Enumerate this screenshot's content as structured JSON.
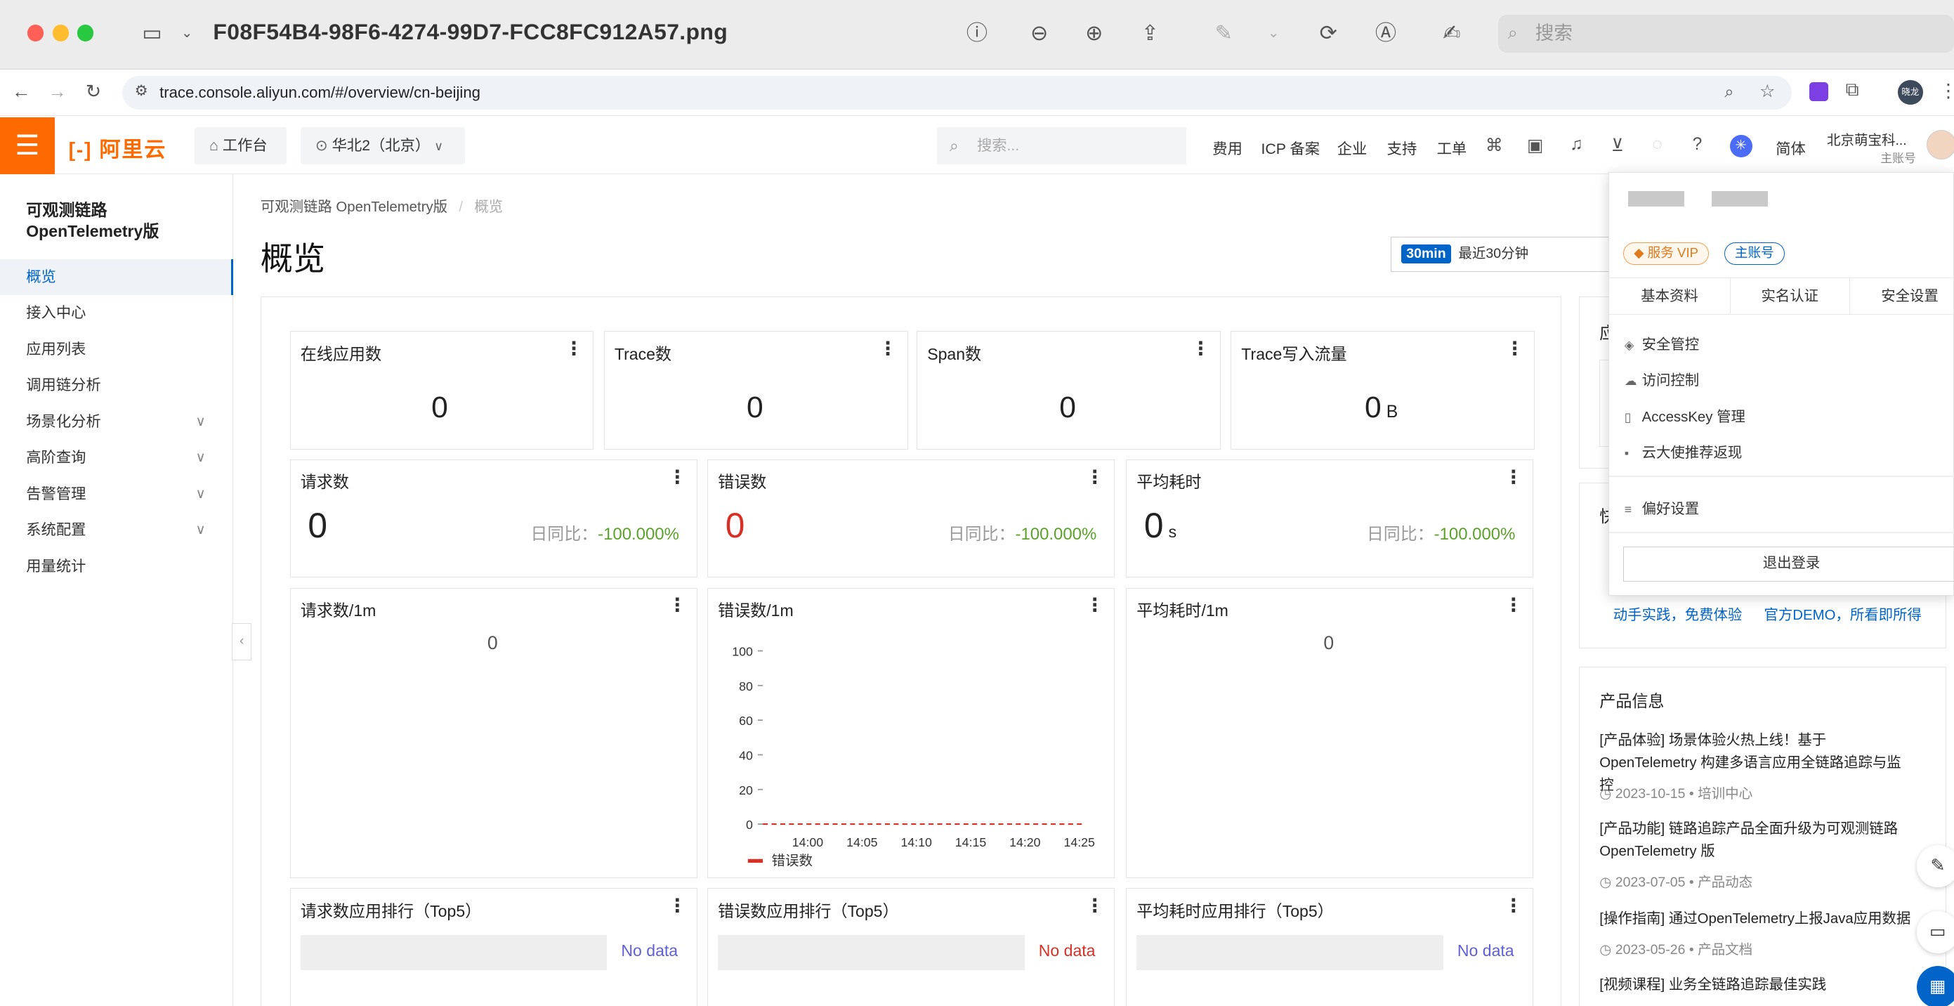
{
  "mac": {
    "filename": "F08F54B4-98F6-4274-99D7-FCC8FC912A57.png",
    "search_placeholder": "搜索"
  },
  "browser": {
    "url": "trace.console.aliyun.com/#/overview/cn-beijing",
    "profile": "晓龙"
  },
  "topnav": {
    "logo": "阿里云",
    "workspace": "工作台",
    "region": "华北2（北京）",
    "search_placeholder": "搜索...",
    "links": [
      "费用",
      "ICP 备案",
      "企业",
      "支持",
      "工单"
    ],
    "lang": "简体",
    "account_name": "北京萌宝科...",
    "account_role": "主账号"
  },
  "sidebar": {
    "title_line1": "可观测链路",
    "title_line2": "OpenTelemetry版",
    "items": [
      {
        "label": "概览"
      },
      {
        "label": "接入中心"
      },
      {
        "label": "应用列表"
      },
      {
        "label": "调用链分析"
      },
      {
        "label": "场景化分析"
      },
      {
        "label": "高阶查询"
      },
      {
        "label": "告警管理"
      },
      {
        "label": "系统配置"
      },
      {
        "label": "用量统计"
      }
    ]
  },
  "breadcrumb": {
    "root": "可观测链路 OpenTelemetry版",
    "sep": "/",
    "current": "概览"
  },
  "page_title": "概览",
  "time_range": {
    "badge": "30min",
    "label": "最近30分钟"
  },
  "stats_row1": [
    {
      "title": "在线应用数",
      "value": "0",
      "unit": ""
    },
    {
      "title": "Trace数",
      "value": "0",
      "unit": ""
    },
    {
      "title": "Span数",
      "value": "0",
      "unit": ""
    },
    {
      "title": "Trace写入流量",
      "value": "0",
      "unit": "B"
    }
  ],
  "stats_row2": [
    {
      "title": "请求数",
      "value": "0",
      "unit": "",
      "cmp_label": "日同比：",
      "cmp_value": "-100.000%"
    },
    {
      "title": "错误数",
      "value": "0",
      "unit": "",
      "cmp_label": "日同比：",
      "cmp_value": "-100.000%"
    },
    {
      "title": "平均耗时",
      "value": "0",
      "unit": "s",
      "cmp_label": "日同比：",
      "cmp_value": "-100.000%"
    }
  ],
  "charts_row": [
    {
      "title": "请求数/1m",
      "value": "0"
    },
    {
      "title": "错误数/1m"
    },
    {
      "title": "平均耗时/1m",
      "value": "0"
    }
  ],
  "chart_data": {
    "type": "line",
    "x": [
      "14:00",
      "14:05",
      "14:10",
      "14:15",
      "14:20",
      "14:25"
    ],
    "series": [
      {
        "name": "错误数",
        "values": [
          0,
          0,
          0,
          0,
          0,
          0
        ]
      }
    ],
    "ylim": [
      0,
      100
    ],
    "yticks": [
      "100",
      "80",
      "60",
      "40",
      "20",
      "0"
    ],
    "color": "#d93026"
  },
  "rank_row": [
    {
      "title": "请求数应用排行（Top5）",
      "nodata": "No data"
    },
    {
      "title": "错误数应用排行（Top5）",
      "nodata": "No data"
    },
    {
      "title": "平均耗时应用排行（Top5）",
      "nodata": "No data"
    }
  ],
  "right_col": {
    "box1_partial_title": "应",
    "box2_partial_title": "快",
    "links": [
      "动手实践，免费体验",
      "官方DEMO，所看即所得"
    ],
    "product_info_title": "产品信息",
    "news": [
      {
        "title": "[产品体验] 场景体验火热上线！基于 OpenTelemetry 构建多语言应用全链路追踪与监控",
        "date": "2023-10-15",
        "tag": "培训中心"
      },
      {
        "title": "[产品功能] 链路追踪产品全面升级为可观测链路 OpenTelemetry 版",
        "date": "2023-07-05",
        "tag": "产品动态"
      },
      {
        "title": "[操作指南] 通过OpenTelemetry上报Java应用数据",
        "date": "2023-05-26",
        "tag": "产品文档"
      },
      {
        "title": "[视频课程] 业务全链路追踪最佳实践",
        "date": "",
        "tag": ""
      }
    ]
  },
  "account_menu": {
    "badge_vip": "服务 VIP",
    "badge_main": "主账号",
    "tabs": [
      "基本资料",
      "实名认证",
      "安全设置"
    ],
    "items": [
      "安全管控",
      "访问控制",
      "AccessKey 管理",
      "云大使推荐返现"
    ],
    "prefs": "偏好设置",
    "logout": "退出登录"
  },
  "colors": {
    "accent": "#0064c8",
    "brand": "#ff6a00",
    "error": "#d93026",
    "positive": "#5ca22a",
    "link": "#0064c8"
  }
}
